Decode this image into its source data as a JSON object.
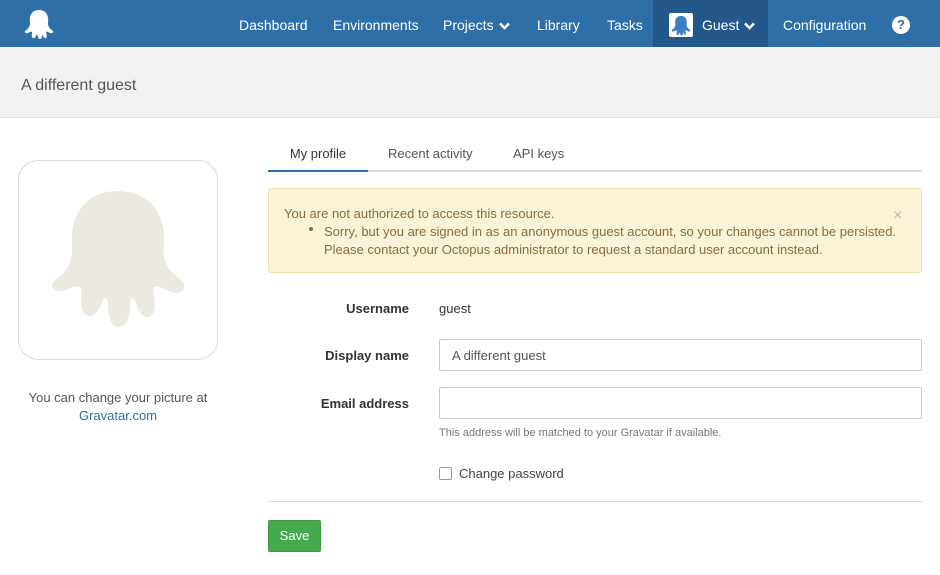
{
  "nav": {
    "items": [
      {
        "label": "Dashboard"
      },
      {
        "label": "Environments"
      },
      {
        "label": "Projects"
      },
      {
        "label": "Library"
      },
      {
        "label": "Tasks"
      },
      {
        "label": "Guest"
      },
      {
        "label": "Configuration"
      }
    ],
    "help_label": "?"
  },
  "page": {
    "title": "A different guest"
  },
  "avatar": {
    "change_text": "You can change your picture at",
    "gravatar_link": "Gravatar.com"
  },
  "tabs": [
    {
      "label": "My profile",
      "active": true
    },
    {
      "label": "Recent activity",
      "active": false
    },
    {
      "label": "API keys",
      "active": false
    }
  ],
  "alert": {
    "title": "You are not authorized to access this resource.",
    "message": "Sorry, but you are signed in as an anonymous guest account, so your changes cannot be persisted. Please contact your Octopus administrator to request a standard user account instead.",
    "close": "×"
  },
  "form": {
    "username_label": "Username",
    "username_value": "guest",
    "display_name_label": "Display name",
    "display_name_value": "A different guest",
    "email_label": "Email address",
    "email_value": "",
    "email_help": "This address will be matched to your Gravatar if available.",
    "change_password_label": "Change password",
    "save_label": "Save"
  },
  "colors": {
    "nav_bg": "#2f6fa8",
    "nav_active_bg": "#24588a",
    "alert_bg": "#faf3d7",
    "save_bg": "#45a94d"
  }
}
